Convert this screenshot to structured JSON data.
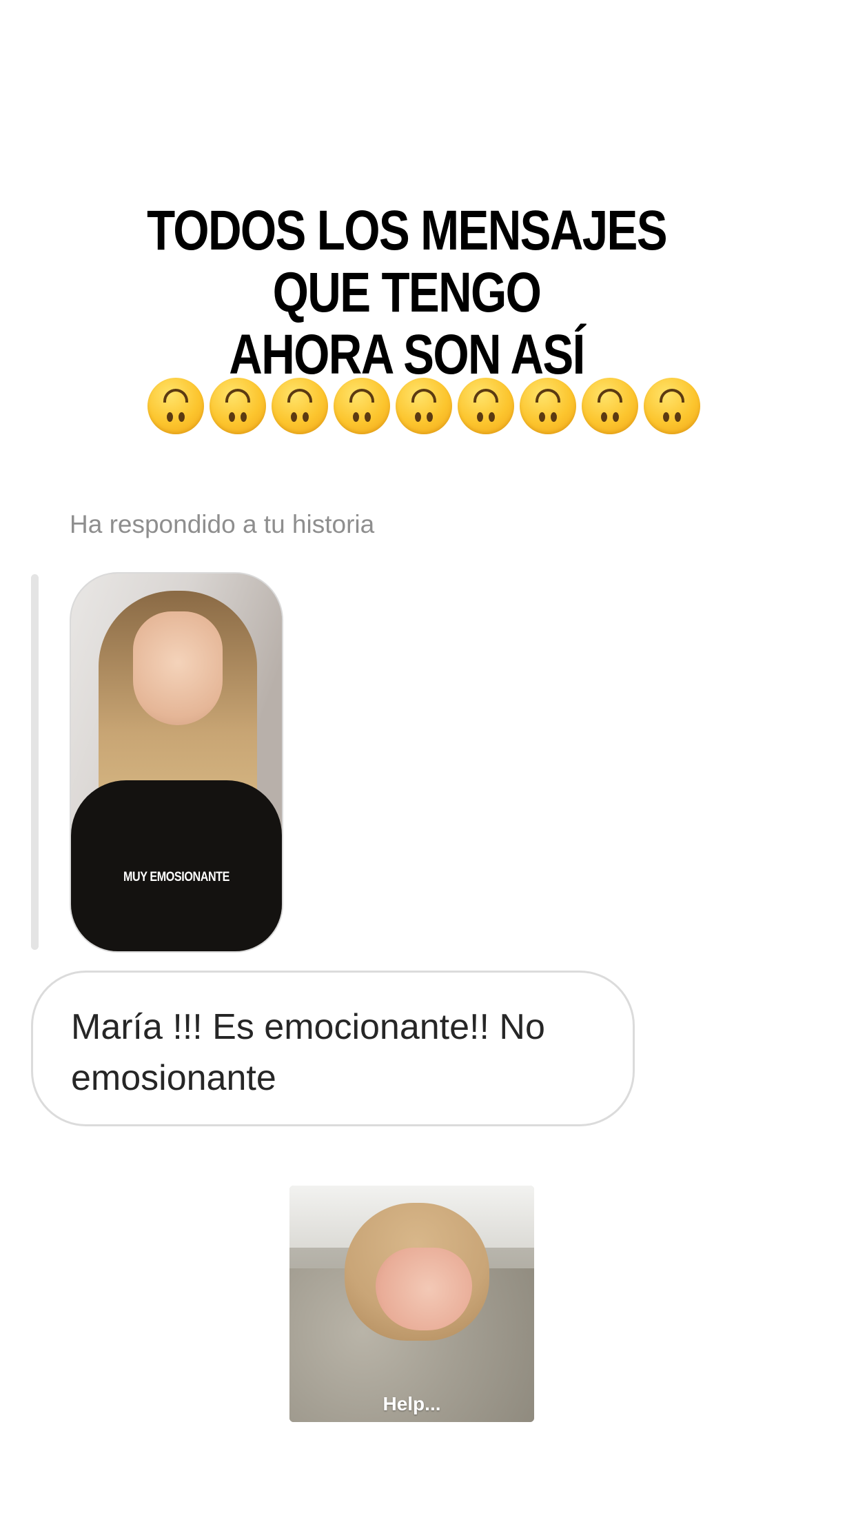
{
  "headline": {
    "line1": "TODOS LOS MENSAJES QUE TENGO",
    "line2": "AHORA SON ASÍ"
  },
  "emoji_row": {
    "icon": "upside-down-face-icon",
    "count": 9
  },
  "reply": {
    "label": "Ha respondido a tu historia"
  },
  "story": {
    "caption": "MUY EMOSIONANTE"
  },
  "message": {
    "text": "María !!! Es emocionante!! No emosionante"
  },
  "gif": {
    "caption": "Help..."
  }
}
